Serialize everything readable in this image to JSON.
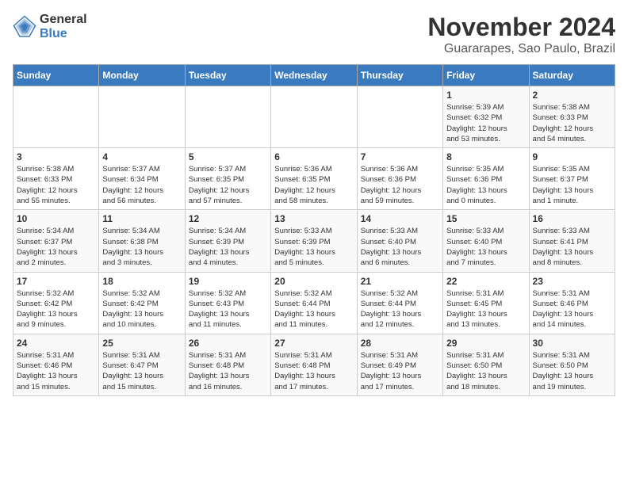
{
  "logo": {
    "general": "General",
    "blue": "Blue"
  },
  "title": "November 2024",
  "subtitle": "Guararapes, Sao Paulo, Brazil",
  "days_of_week": [
    "Sunday",
    "Monday",
    "Tuesday",
    "Wednesday",
    "Thursday",
    "Friday",
    "Saturday"
  ],
  "weeks": [
    [
      {
        "day": "",
        "info": ""
      },
      {
        "day": "",
        "info": ""
      },
      {
        "day": "",
        "info": ""
      },
      {
        "day": "",
        "info": ""
      },
      {
        "day": "",
        "info": ""
      },
      {
        "day": "1",
        "info": "Sunrise: 5:39 AM\nSunset: 6:32 PM\nDaylight: 12 hours\nand 53 minutes."
      },
      {
        "day": "2",
        "info": "Sunrise: 5:38 AM\nSunset: 6:33 PM\nDaylight: 12 hours\nand 54 minutes."
      }
    ],
    [
      {
        "day": "3",
        "info": "Sunrise: 5:38 AM\nSunset: 6:33 PM\nDaylight: 12 hours\nand 55 minutes."
      },
      {
        "day": "4",
        "info": "Sunrise: 5:37 AM\nSunset: 6:34 PM\nDaylight: 12 hours\nand 56 minutes."
      },
      {
        "day": "5",
        "info": "Sunrise: 5:37 AM\nSunset: 6:35 PM\nDaylight: 12 hours\nand 57 minutes."
      },
      {
        "day": "6",
        "info": "Sunrise: 5:36 AM\nSunset: 6:35 PM\nDaylight: 12 hours\nand 58 minutes."
      },
      {
        "day": "7",
        "info": "Sunrise: 5:36 AM\nSunset: 6:36 PM\nDaylight: 12 hours\nand 59 minutes."
      },
      {
        "day": "8",
        "info": "Sunrise: 5:35 AM\nSunset: 6:36 PM\nDaylight: 13 hours\nand 0 minutes."
      },
      {
        "day": "9",
        "info": "Sunrise: 5:35 AM\nSunset: 6:37 PM\nDaylight: 13 hours\nand 1 minute."
      }
    ],
    [
      {
        "day": "10",
        "info": "Sunrise: 5:34 AM\nSunset: 6:37 PM\nDaylight: 13 hours\nand 2 minutes."
      },
      {
        "day": "11",
        "info": "Sunrise: 5:34 AM\nSunset: 6:38 PM\nDaylight: 13 hours\nand 3 minutes."
      },
      {
        "day": "12",
        "info": "Sunrise: 5:34 AM\nSunset: 6:39 PM\nDaylight: 13 hours\nand 4 minutes."
      },
      {
        "day": "13",
        "info": "Sunrise: 5:33 AM\nSunset: 6:39 PM\nDaylight: 13 hours\nand 5 minutes."
      },
      {
        "day": "14",
        "info": "Sunrise: 5:33 AM\nSunset: 6:40 PM\nDaylight: 13 hours\nand 6 minutes."
      },
      {
        "day": "15",
        "info": "Sunrise: 5:33 AM\nSunset: 6:40 PM\nDaylight: 13 hours\nand 7 minutes."
      },
      {
        "day": "16",
        "info": "Sunrise: 5:33 AM\nSunset: 6:41 PM\nDaylight: 13 hours\nand 8 minutes."
      }
    ],
    [
      {
        "day": "17",
        "info": "Sunrise: 5:32 AM\nSunset: 6:42 PM\nDaylight: 13 hours\nand 9 minutes."
      },
      {
        "day": "18",
        "info": "Sunrise: 5:32 AM\nSunset: 6:42 PM\nDaylight: 13 hours\nand 10 minutes."
      },
      {
        "day": "19",
        "info": "Sunrise: 5:32 AM\nSunset: 6:43 PM\nDaylight: 13 hours\nand 11 minutes."
      },
      {
        "day": "20",
        "info": "Sunrise: 5:32 AM\nSunset: 6:44 PM\nDaylight: 13 hours\nand 11 minutes."
      },
      {
        "day": "21",
        "info": "Sunrise: 5:32 AM\nSunset: 6:44 PM\nDaylight: 13 hours\nand 12 minutes."
      },
      {
        "day": "22",
        "info": "Sunrise: 5:31 AM\nSunset: 6:45 PM\nDaylight: 13 hours\nand 13 minutes."
      },
      {
        "day": "23",
        "info": "Sunrise: 5:31 AM\nSunset: 6:46 PM\nDaylight: 13 hours\nand 14 minutes."
      }
    ],
    [
      {
        "day": "24",
        "info": "Sunrise: 5:31 AM\nSunset: 6:46 PM\nDaylight: 13 hours\nand 15 minutes."
      },
      {
        "day": "25",
        "info": "Sunrise: 5:31 AM\nSunset: 6:47 PM\nDaylight: 13 hours\nand 15 minutes."
      },
      {
        "day": "26",
        "info": "Sunrise: 5:31 AM\nSunset: 6:48 PM\nDaylight: 13 hours\nand 16 minutes."
      },
      {
        "day": "27",
        "info": "Sunrise: 5:31 AM\nSunset: 6:48 PM\nDaylight: 13 hours\nand 17 minutes."
      },
      {
        "day": "28",
        "info": "Sunrise: 5:31 AM\nSunset: 6:49 PM\nDaylight: 13 hours\nand 17 minutes."
      },
      {
        "day": "29",
        "info": "Sunrise: 5:31 AM\nSunset: 6:50 PM\nDaylight: 13 hours\nand 18 minutes."
      },
      {
        "day": "30",
        "info": "Sunrise: 5:31 AM\nSunset: 6:50 PM\nDaylight: 13 hours\nand 19 minutes."
      }
    ]
  ]
}
